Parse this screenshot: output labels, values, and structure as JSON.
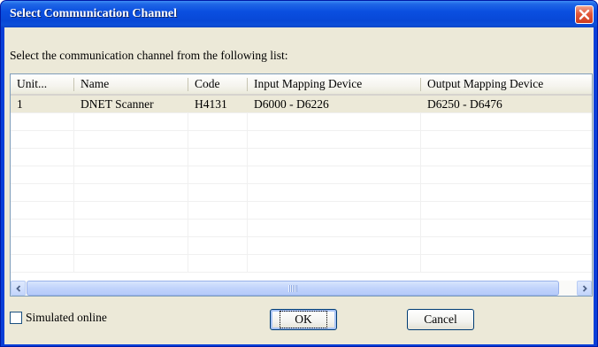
{
  "dialog": {
    "title": "Select Communication Channel",
    "prompt": "Select the communication channel from the following list:"
  },
  "list": {
    "columns": [
      "Unit...",
      "Name",
      "Code",
      "Input Mapping Device",
      "Output Mapping Device"
    ],
    "rows": [
      [
        "1",
        "DNET Scanner",
        "H4131",
        "D6000 - D6226",
        "D6250 - D6476"
      ]
    ],
    "selected_row": 0
  },
  "footer": {
    "simulated_label": "Simulated online",
    "simulated_checked": false,
    "ok_label": "OK",
    "cancel_label": "Cancel"
  },
  "icons": {
    "close": "close-icon",
    "scroll_left": "left-arrow-icon",
    "scroll_right": "right-arrow-icon"
  },
  "colors": {
    "titlebar": "#0a4fe0",
    "close_button": "#e2583a",
    "dialog_face": "#ece9d8",
    "selected_row": "#ece9d8"
  }
}
